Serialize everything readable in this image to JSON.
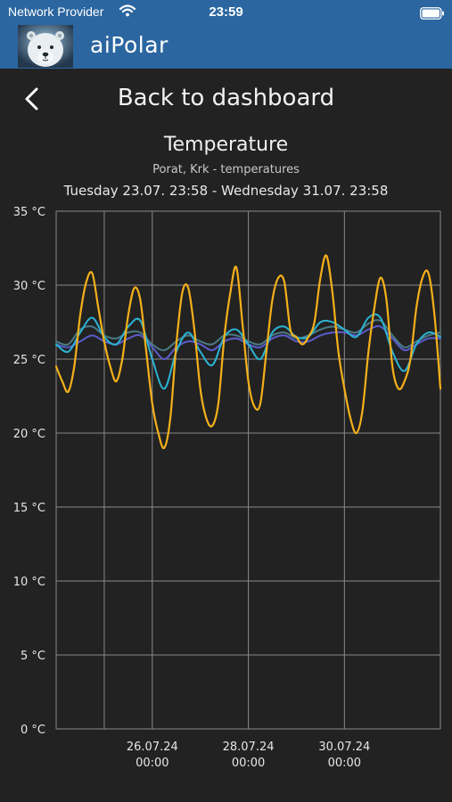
{
  "status_bar": {
    "carrier": "Network Provider",
    "time": "23:59",
    "wifi_icon": "wifi-icon",
    "battery_icon": "battery-icon"
  },
  "app_bar": {
    "title": "aiPolar",
    "logo_icon": "polar-bear-logo",
    "color": "#2b66a0"
  },
  "nav": {
    "back_icon": "chevron-left-icon",
    "back_label": "Back to dashboard"
  },
  "chart_header": {
    "title": "Temperature",
    "subtitle": "Porat, Krk - temperatures",
    "range": "Tuesday 23.07. 23:58  - Wednesday 31.07. 23:58"
  },
  "chart_data": {
    "type": "line",
    "ylim": [
      0,
      35
    ],
    "xlim": [
      "2024-07-23 23:58",
      "2024-07-31 23:58"
    ],
    "y_ticks": [
      0,
      5,
      10,
      15,
      20,
      25,
      30,
      35
    ],
    "y_tick_labels": [
      "0 °C",
      "5 °C",
      "10 °C",
      "15 °C",
      "20 °C",
      "25 °C",
      "30 °C",
      "35 °C"
    ],
    "x_ticks": [
      {
        "at": "2024-07-25 00:00",
        "line1": "",
        "line2": ""
      },
      {
        "at": "2024-07-26 00:00",
        "line1": "26.07.24",
        "line2": "00:00"
      },
      {
        "at": "2024-07-28 00:00",
        "line1": "28.07.24",
        "line2": "00:00"
      },
      {
        "at": "2024-07-30 00:00",
        "line1": "30.07.24",
        "line2": "00:00"
      }
    ],
    "grid": true,
    "series": [
      {
        "color": "#f5b01a",
        "x": [
          "2024-07-23 23:58",
          "2024-07-24 03:00",
          "2024-07-24 06:00",
          "2024-07-24 09:00",
          "2024-07-24 12:00",
          "2024-07-24 15:00",
          "2024-07-24 18:00",
          "2024-07-24 21:00",
          "2024-07-25 00:00",
          "2024-07-25 03:00",
          "2024-07-25 06:00",
          "2024-07-25 09:00",
          "2024-07-25 12:00",
          "2024-07-25 15:00",
          "2024-07-25 18:00",
          "2024-07-25 21:00",
          "2024-07-26 00:00",
          "2024-07-26 03:00",
          "2024-07-26 06:00",
          "2024-07-26 09:00",
          "2024-07-26 12:00",
          "2024-07-26 15:00",
          "2024-07-26 18:00",
          "2024-07-26 21:00",
          "2024-07-27 00:00",
          "2024-07-27 03:00",
          "2024-07-27 06:00",
          "2024-07-27 09:00",
          "2024-07-27 12:00",
          "2024-07-27 15:00",
          "2024-07-27 18:00",
          "2024-07-27 21:00",
          "2024-07-28 00:00",
          "2024-07-28 03:00",
          "2024-07-28 06:00",
          "2024-07-28 09:00",
          "2024-07-28 12:00",
          "2024-07-28 15:00",
          "2024-07-28 18:00",
          "2024-07-28 21:00",
          "2024-07-29 00:00",
          "2024-07-29 03:00",
          "2024-07-29 06:00",
          "2024-07-29 09:00",
          "2024-07-29 12:00",
          "2024-07-29 15:00",
          "2024-07-29 18:00",
          "2024-07-29 21:00",
          "2024-07-30 00:00",
          "2024-07-30 03:00",
          "2024-07-30 06:00",
          "2024-07-30 09:00",
          "2024-07-30 12:00",
          "2024-07-30 15:00",
          "2024-07-30 18:00",
          "2024-07-30 21:00",
          "2024-07-31 00:00",
          "2024-07-31 03:00",
          "2024-07-31 06:00",
          "2024-07-31 09:00",
          "2024-07-31 12:00",
          "2024-07-31 15:00",
          "2024-07-31 18:00",
          "2024-07-31 21:00",
          "2024-07-31 23:58"
        ],
        "values": [
          24.5,
          23.5,
          22.8,
          24.5,
          28.0,
          30.2,
          30.8,
          28.5,
          26.2,
          24.5,
          23.5,
          25.0,
          28.0,
          29.8,
          29.0,
          25.5,
          22.0,
          20.0,
          19.0,
          21.0,
          26.0,
          29.5,
          29.8,
          27.0,
          23.0,
          21.0,
          20.5,
          22.0,
          26.5,
          29.5,
          31.2,
          27.5,
          23.5,
          21.8,
          22.0,
          25.5,
          29.0,
          30.5,
          30.2,
          27.0,
          26.5,
          26.0,
          26.5,
          27.5,
          30.5,
          32.0,
          29.5,
          25.5,
          23.0,
          21.0,
          20.0,
          21.5,
          25.5,
          28.5,
          30.5,
          29.0,
          24.5,
          23.0,
          23.5,
          25.0,
          28.5,
          30.5,
          30.8,
          28.0,
          23.0
        ]
      },
      {
        "color": "#2ab3d4",
        "x": [
          "2024-07-23 23:58",
          "2024-07-24 06:00",
          "2024-07-24 12:00",
          "2024-07-24 18:00",
          "2024-07-25 00:00",
          "2024-07-25 06:00",
          "2024-07-25 12:00",
          "2024-07-25 18:00",
          "2024-07-26 00:00",
          "2024-07-26 06:00",
          "2024-07-26 12:00",
          "2024-07-26 18:00",
          "2024-07-27 00:00",
          "2024-07-27 06:00",
          "2024-07-27 12:00",
          "2024-07-27 18:00",
          "2024-07-28 00:00",
          "2024-07-28 06:00",
          "2024-07-28 12:00",
          "2024-07-28 18:00",
          "2024-07-29 00:00",
          "2024-07-29 06:00",
          "2024-07-29 12:00",
          "2024-07-29 18:00",
          "2024-07-30 00:00",
          "2024-07-30 06:00",
          "2024-07-30 12:00",
          "2024-07-30 18:00",
          "2024-07-31 00:00",
          "2024-07-31 06:00",
          "2024-07-31 12:00",
          "2024-07-31 18:00",
          "2024-07-31 23:58"
        ],
        "values": [
          26.0,
          25.5,
          26.8,
          27.8,
          26.5,
          26.0,
          27.2,
          27.6,
          25.0,
          23.0,
          25.5,
          26.8,
          25.5,
          24.6,
          26.5,
          27.0,
          26.0,
          25.0,
          26.8,
          27.2,
          26.5,
          26.5,
          27.5,
          27.5,
          27.0,
          26.5,
          27.8,
          27.8,
          25.5,
          24.2,
          26.0,
          26.8,
          26.5
        ]
      },
      {
        "color": "#5b5ccc",
        "x": [
          "2024-07-23 23:58",
          "2024-07-24 06:00",
          "2024-07-24 12:00",
          "2024-07-24 18:00",
          "2024-07-25 00:00",
          "2024-07-25 06:00",
          "2024-07-25 12:00",
          "2024-07-25 18:00",
          "2024-07-26 00:00",
          "2024-07-26 06:00",
          "2024-07-26 12:00",
          "2024-07-26 18:00",
          "2024-07-27 00:00",
          "2024-07-27 06:00",
          "2024-07-27 12:00",
          "2024-07-27 18:00",
          "2024-07-28 00:00",
          "2024-07-28 06:00",
          "2024-07-28 12:00",
          "2024-07-28 18:00",
          "2024-07-29 00:00",
          "2024-07-29 06:00",
          "2024-07-29 12:00",
          "2024-07-29 18:00",
          "2024-07-30 00:00",
          "2024-07-30 06:00",
          "2024-07-30 12:00",
          "2024-07-30 18:00",
          "2024-07-31 00:00",
          "2024-07-31 06:00",
          "2024-07-31 12:00",
          "2024-07-31 18:00",
          "2024-07-31 23:58"
        ],
        "values": [
          26.0,
          25.8,
          26.2,
          26.6,
          26.2,
          26.0,
          26.4,
          26.6,
          25.8,
          25.0,
          25.8,
          26.2,
          26.0,
          25.6,
          26.2,
          26.4,
          26.0,
          25.8,
          26.4,
          26.6,
          26.2,
          26.2,
          26.6,
          26.8,
          26.8,
          26.6,
          27.0,
          27.2,
          26.4,
          25.6,
          26.0,
          26.4,
          26.4
        ]
      },
      {
        "color": "#4a7b86",
        "x": [
          "2024-07-23 23:58",
          "2024-07-24 06:00",
          "2024-07-24 12:00",
          "2024-07-24 18:00",
          "2024-07-25 00:00",
          "2024-07-25 06:00",
          "2024-07-25 12:00",
          "2024-07-25 18:00",
          "2024-07-26 00:00",
          "2024-07-26 06:00",
          "2024-07-26 12:00",
          "2024-07-26 18:00",
          "2024-07-27 00:00",
          "2024-07-27 06:00",
          "2024-07-27 12:00",
          "2024-07-27 18:00",
          "2024-07-28 00:00",
          "2024-07-28 06:00",
          "2024-07-28 12:00",
          "2024-07-28 18:00",
          "2024-07-29 00:00",
          "2024-07-29 06:00",
          "2024-07-29 12:00",
          "2024-07-29 18:00",
          "2024-07-30 00:00",
          "2024-07-30 06:00",
          "2024-07-30 12:00",
          "2024-07-30 18:00",
          "2024-07-31 00:00",
          "2024-07-31 06:00",
          "2024-07-31 12:00",
          "2024-07-31 18:00",
          "2024-07-31 23:58"
        ],
        "values": [
          26.2,
          26.0,
          27.0,
          27.2,
          26.6,
          26.4,
          26.8,
          26.8,
          26.0,
          25.6,
          26.2,
          26.6,
          26.2,
          26.0,
          26.6,
          26.6,
          26.2,
          26.0,
          26.6,
          26.8,
          26.4,
          26.6,
          27.0,
          27.2,
          27.0,
          26.8,
          27.4,
          27.6,
          26.6,
          25.8,
          26.2,
          26.6,
          26.8
        ]
      }
    ]
  }
}
